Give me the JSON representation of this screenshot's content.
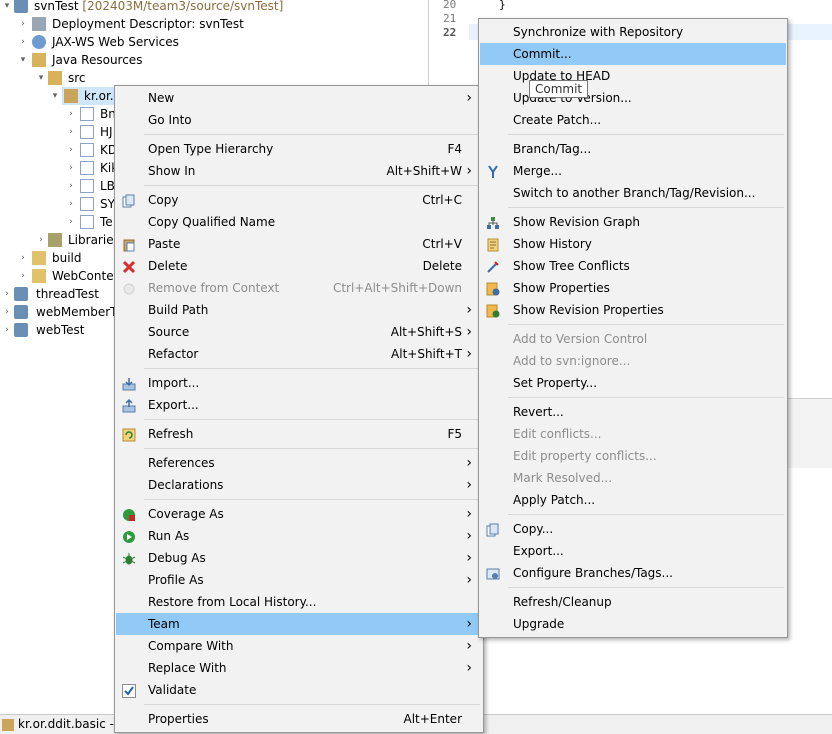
{
  "explorer": {
    "project": {
      "name": "svnTest",
      "suffix": " [202403M/team3/source/svnTest]"
    },
    "deployment_descriptor": "Deployment Descriptor: svnTest",
    "jaxws": "JAX-WS Web Services",
    "java_resources": "Java Resources",
    "src": "src",
    "package": "kr.or.d",
    "files": [
      "Bn",
      "HJ",
      "KD",
      "Kik",
      "LB",
      "SY",
      "Te"
    ],
    "libraries": "Libraries",
    "build": "build",
    "webcontent": "WebConten",
    "projects": [
      "threadTest",
      "webMemberTe",
      "webTest"
    ]
  },
  "editor": {
    "line_numbers": [
      "20",
      "21",
      "22"
    ],
    "code_line_20": "}"
  },
  "statusbar": {
    "text": "kr.or.ddit.basic - s"
  },
  "context_menu": {
    "items": [
      {
        "label": "New",
        "submenu": true
      },
      {
        "label": "Go Into"
      },
      {
        "sep": true
      },
      {
        "label": "Open Type Hierarchy",
        "key": "F4"
      },
      {
        "label": "Show In",
        "key": "Alt+Shift+W",
        "submenu": true
      },
      {
        "sep": true
      },
      {
        "label": "Copy",
        "key": "Ctrl+C",
        "icon": "copy-icon"
      },
      {
        "label": "Copy Qualified Name"
      },
      {
        "label": "Paste",
        "key": "Ctrl+V",
        "icon": "paste-icon"
      },
      {
        "label": "Delete",
        "key": "Delete",
        "icon": "delete-icon"
      },
      {
        "label": "Remove from Context",
        "key": "Ctrl+Alt+Shift+Down",
        "disabled": true,
        "icon": "remove-context-icon"
      },
      {
        "label": "Build Path",
        "submenu": true
      },
      {
        "label": "Source",
        "key": "Alt+Shift+S",
        "submenu": true
      },
      {
        "label": "Refactor",
        "key": "Alt+Shift+T",
        "submenu": true
      },
      {
        "sep": true
      },
      {
        "label": "Import...",
        "icon": "import-icon"
      },
      {
        "label": "Export...",
        "icon": "export-icon"
      },
      {
        "sep": true
      },
      {
        "label": "Refresh",
        "key": "F5",
        "icon": "refresh-icon"
      },
      {
        "sep": true
      },
      {
        "label": "References",
        "submenu": true
      },
      {
        "label": "Declarations",
        "submenu": true
      },
      {
        "sep": true
      },
      {
        "label": "Coverage As",
        "submenu": true,
        "icon": "coverage-icon"
      },
      {
        "label": "Run As",
        "submenu": true,
        "icon": "run-icon"
      },
      {
        "label": "Debug As",
        "submenu": true,
        "icon": "debug-icon"
      },
      {
        "label": "Profile As",
        "submenu": true
      },
      {
        "label": "Restore from Local History..."
      },
      {
        "label": "Team",
        "submenu": true,
        "selected": true
      },
      {
        "label": "Compare With",
        "submenu": true
      },
      {
        "label": "Replace With",
        "submenu": true
      },
      {
        "label": "Validate",
        "icon": "checkmark-icon"
      },
      {
        "sep": true
      },
      {
        "label": "Properties",
        "key": "Alt+Enter"
      }
    ]
  },
  "team_menu": {
    "items": [
      {
        "label": "Synchronize with Repository"
      },
      {
        "label": "Commit...",
        "selected": true
      },
      {
        "label": "Update to HEAD"
      },
      {
        "label": "Update to Version..."
      },
      {
        "label": "Create Patch..."
      },
      {
        "sep": true
      },
      {
        "label": "Branch/Tag..."
      },
      {
        "label": "Merge...",
        "icon": "merge-icon"
      },
      {
        "label": "Switch to another Branch/Tag/Revision..."
      },
      {
        "sep": true
      },
      {
        "label": "Show Revision Graph",
        "icon": "revision-graph-icon"
      },
      {
        "label": "Show History",
        "icon": "history-icon"
      },
      {
        "label": "Show Tree Conflicts",
        "icon": "tree-conflicts-icon"
      },
      {
        "label": "Show Properties",
        "icon": "properties-icon"
      },
      {
        "label": "Show Revision Properties",
        "icon": "revision-properties-icon"
      },
      {
        "sep": true
      },
      {
        "label": "Add to Version Control",
        "disabled": true
      },
      {
        "label": "Add to svn:ignore...",
        "disabled": true
      },
      {
        "label": "Set Property..."
      },
      {
        "sep": true
      },
      {
        "label": "Revert..."
      },
      {
        "label": "Edit conflicts...",
        "disabled": true
      },
      {
        "label": "Edit property conflicts...",
        "disabled": true
      },
      {
        "label": "Mark Resolved...",
        "disabled": true
      },
      {
        "label": "Apply Patch..."
      },
      {
        "sep": true
      },
      {
        "label": "Copy...",
        "icon": "copy-icon"
      },
      {
        "label": "Export..."
      },
      {
        "label": "Configure Branches/Tags...",
        "icon": "configure-icon"
      },
      {
        "sep": true
      },
      {
        "label": "Refresh/Cleanup"
      },
      {
        "label": "Upgrade"
      }
    ]
  },
  "tooltip": {
    "text": "Commit"
  }
}
